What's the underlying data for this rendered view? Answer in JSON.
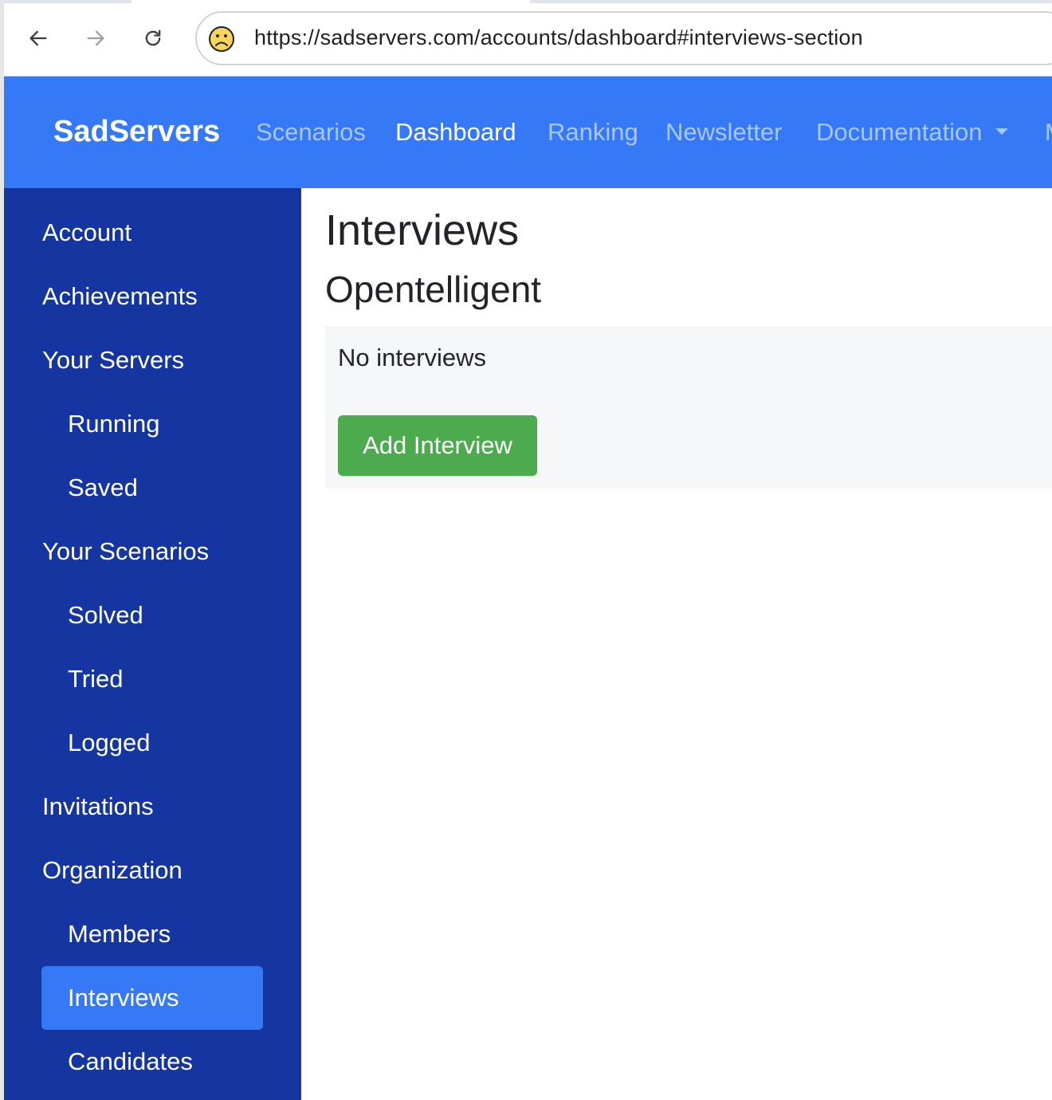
{
  "browser": {
    "url": "https://sadservers.com/accounts/dashboard#interviews-section"
  },
  "navbar": {
    "brand": "SadServers",
    "links": [
      {
        "label": "Scenarios"
      },
      {
        "label": "Dashboard"
      },
      {
        "label": "Ranking"
      },
      {
        "label": "Newsletter"
      },
      {
        "label": "Documentation"
      },
      {
        "label": "M"
      }
    ]
  },
  "sidebar": {
    "items": [
      {
        "label": "Account"
      },
      {
        "label": "Achievements"
      },
      {
        "label": "Your Servers"
      },
      {
        "label": "Running"
      },
      {
        "label": "Saved"
      },
      {
        "label": "Your Scenarios"
      },
      {
        "label": "Solved"
      },
      {
        "label": "Tried"
      },
      {
        "label": "Logged"
      },
      {
        "label": "Invitations"
      },
      {
        "label": "Organization"
      },
      {
        "label": "Members"
      },
      {
        "label": "Interviews"
      },
      {
        "label": "Candidates"
      }
    ]
  },
  "main": {
    "title": "Interviews",
    "organization": "Opentelligent",
    "empty_message": "No interviews",
    "add_button": "Add Interview"
  },
  "colors": {
    "navbar_bg": "#3579f6",
    "sidebar_bg": "#1536a0",
    "active_item_bg": "#3579f6",
    "add_button_bg": "#4caa4f",
    "panel_bg": "#f6f7f9"
  },
  "icons": {
    "back": "arrow-left-icon",
    "forward": "arrow-right-icon",
    "reload": "reload-icon",
    "site_info": "sad-face-icon",
    "dropdown": "caret-down-icon"
  }
}
